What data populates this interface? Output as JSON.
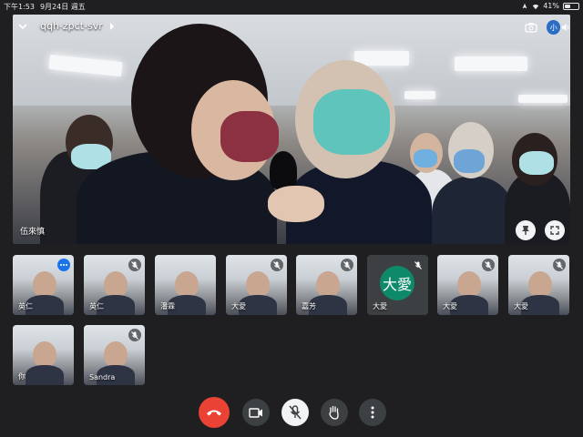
{
  "status_bar": {
    "time": "下午1:53",
    "date": "9月24日 週五",
    "battery_percent": "41%",
    "battery_level": 0.41
  },
  "meeting": {
    "code": "qqh-zpct-svr",
    "presenter_name": "伍來慎",
    "self_avatar_initial": "小"
  },
  "tiles": [
    {
      "name": "英仁",
      "status": "more"
    },
    {
      "name": "英仁",
      "status": "muted"
    },
    {
      "name": "潘霖",
      "status": "none"
    },
    {
      "name": "大愛",
      "status": "muted"
    },
    {
      "name": "嘉芳",
      "status": "muted"
    },
    {
      "name": "大愛",
      "status": "muted",
      "avatar": "大愛"
    },
    {
      "name": "大愛",
      "status": "muted"
    },
    {
      "name": "大愛",
      "status": "muted"
    },
    {
      "name": "你",
      "status": "none"
    },
    {
      "name": "Sandra",
      "status": "muted"
    }
  ],
  "colors": {
    "end_call": "#ea4335",
    "avatar_green": "#0e8a6a",
    "accent_blue": "#1a73e8",
    "background": "#1f1f21"
  },
  "icons": [
    "chevron-down-icon",
    "chevron-right-icon",
    "camera-flip-icon",
    "speaker-icon",
    "pin-icon",
    "fullscreen-icon",
    "mic-off-icon",
    "more-vert-icon",
    "end-call-icon",
    "video-icon",
    "raise-hand-icon"
  ]
}
